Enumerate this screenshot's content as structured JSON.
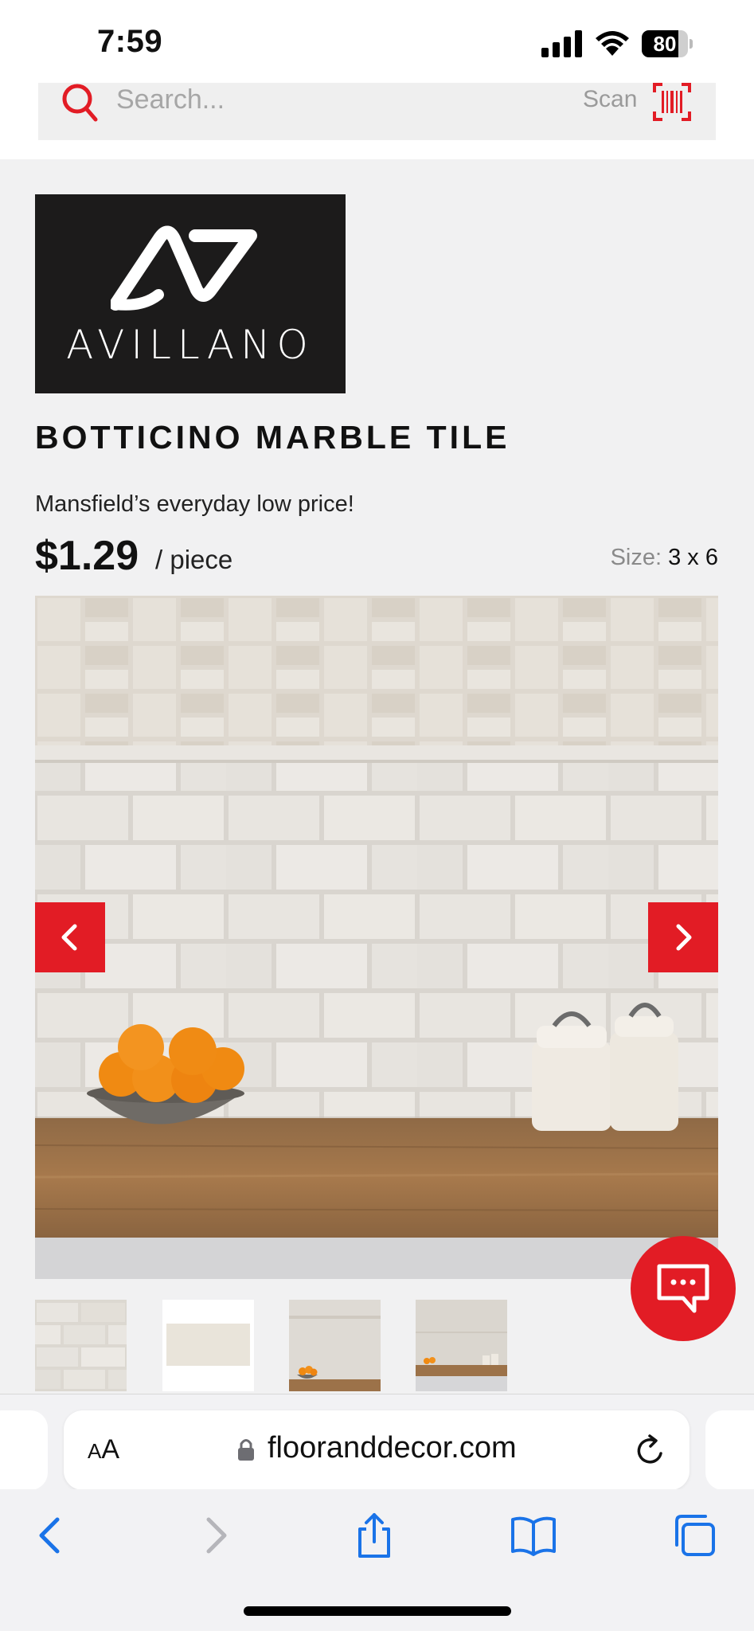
{
  "status_bar": {
    "time": "7:59",
    "battery_level": "80",
    "battery_fraction": 0.8
  },
  "search": {
    "placeholder": "Search...",
    "scan_label": "Scan"
  },
  "brand": {
    "name": "AVILLANO"
  },
  "product": {
    "title": "BOTTICINO MARBLE TILE",
    "promo": "Mansfield’s everyday low price!",
    "price": "$1.29",
    "unit": "/ piece",
    "size_label": "Size:",
    "size_value": "3 x 6"
  },
  "gallery": {
    "thumbnail_count": 4
  },
  "browser": {
    "aa_label_small": "A",
    "aa_label_large": "A",
    "url": "flooranddecor.com"
  },
  "colors": {
    "accent": "#e21c25",
    "ios_blue": "#1a73e8",
    "logo_bg": "#1c1b1b"
  },
  "icons": {
    "search": "search-icon",
    "scan": "barcode-scan-icon",
    "prev": "chevron-left-icon",
    "next": "chevron-right-icon",
    "chat": "chat-bubble-icon",
    "lock": "lock-icon",
    "reload": "reload-icon",
    "back": "back-icon",
    "forward": "forward-icon",
    "share": "share-icon",
    "bookmarks": "bookmarks-icon",
    "tabs": "tabs-icon"
  }
}
